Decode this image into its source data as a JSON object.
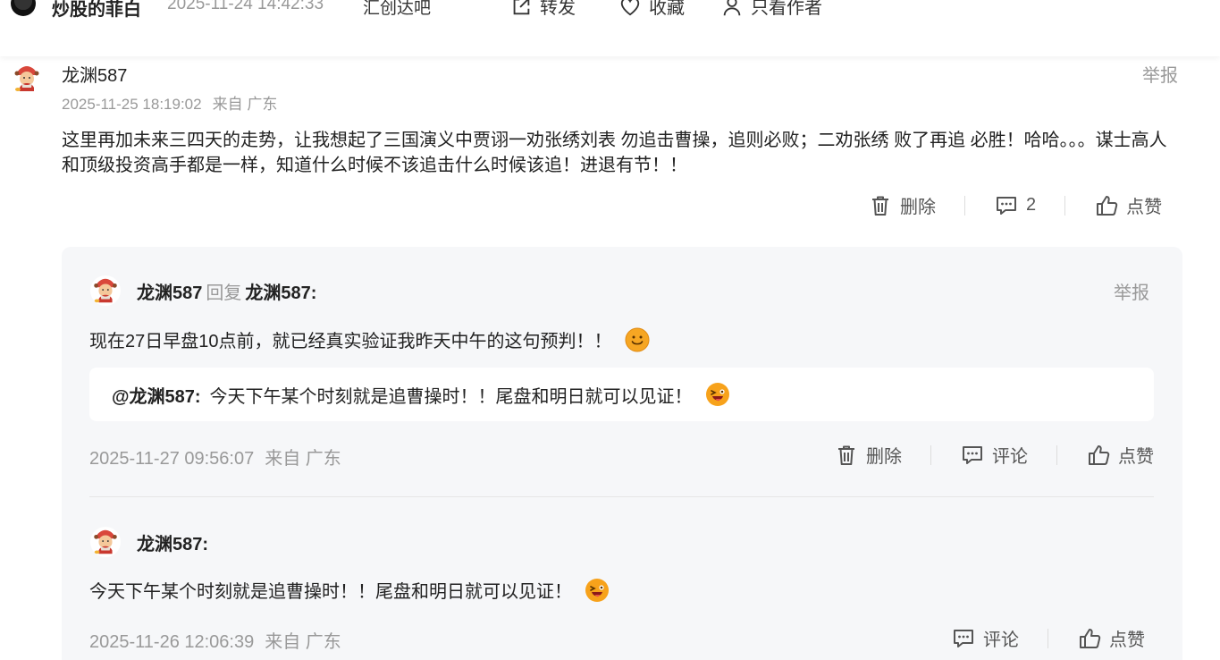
{
  "topbar": {
    "author": "炒股的菲白",
    "time": "2025-11-24 14:42:33",
    "source": "汇创达吧",
    "share_label": "转发",
    "favorite_label": "收藏",
    "author_only_label": "只看作者"
  },
  "comment": {
    "username": "龙渊587",
    "report_label": "举报",
    "time": "2025-11-25 18:19:02",
    "location": "来自 广东",
    "text": "这里再加未来三四天的走势，让我想起了三国演义中贾诩一劝张绣刘表 勿追击曹操，追则必败；二劝张绣 败了再追 必胜！哈哈。。。谋士高人和顶级投资高手都是一样，知道什么时候不该追击什么时候该追！进退有节！！",
    "delete_label": "删除",
    "comment_count": "2",
    "like_label": "点赞"
  },
  "replies": [
    {
      "username": "龙渊587",
      "reply_word": "回复",
      "reply_to": "龙渊587:",
      "report_label": "举报",
      "text": "现在27日早盘10点前，就已经真实验证我昨天中午的这句预判！！",
      "quote_name": "@龙渊587:",
      "quote_text": "今天下午某个时刻就是追曹操时！！尾盘和明日就可以见证！",
      "time": "2025-11-27 09:56:07",
      "location": "来自 广东",
      "delete_label": "删除",
      "comment_label": "评论",
      "like_label": "点赞"
    },
    {
      "username": "龙渊587:",
      "text": "今天下午某个时刻就是追曹操时！！尾盘和明日就可以见证！",
      "time": "2025-11-26 12:06:39",
      "location": "来自 广东",
      "comment_label": "评论",
      "like_label": "点赞"
    }
  ],
  "colors": {
    "muted": "#999999",
    "reply_bg": "#f6f7f9",
    "text": "#222222"
  }
}
